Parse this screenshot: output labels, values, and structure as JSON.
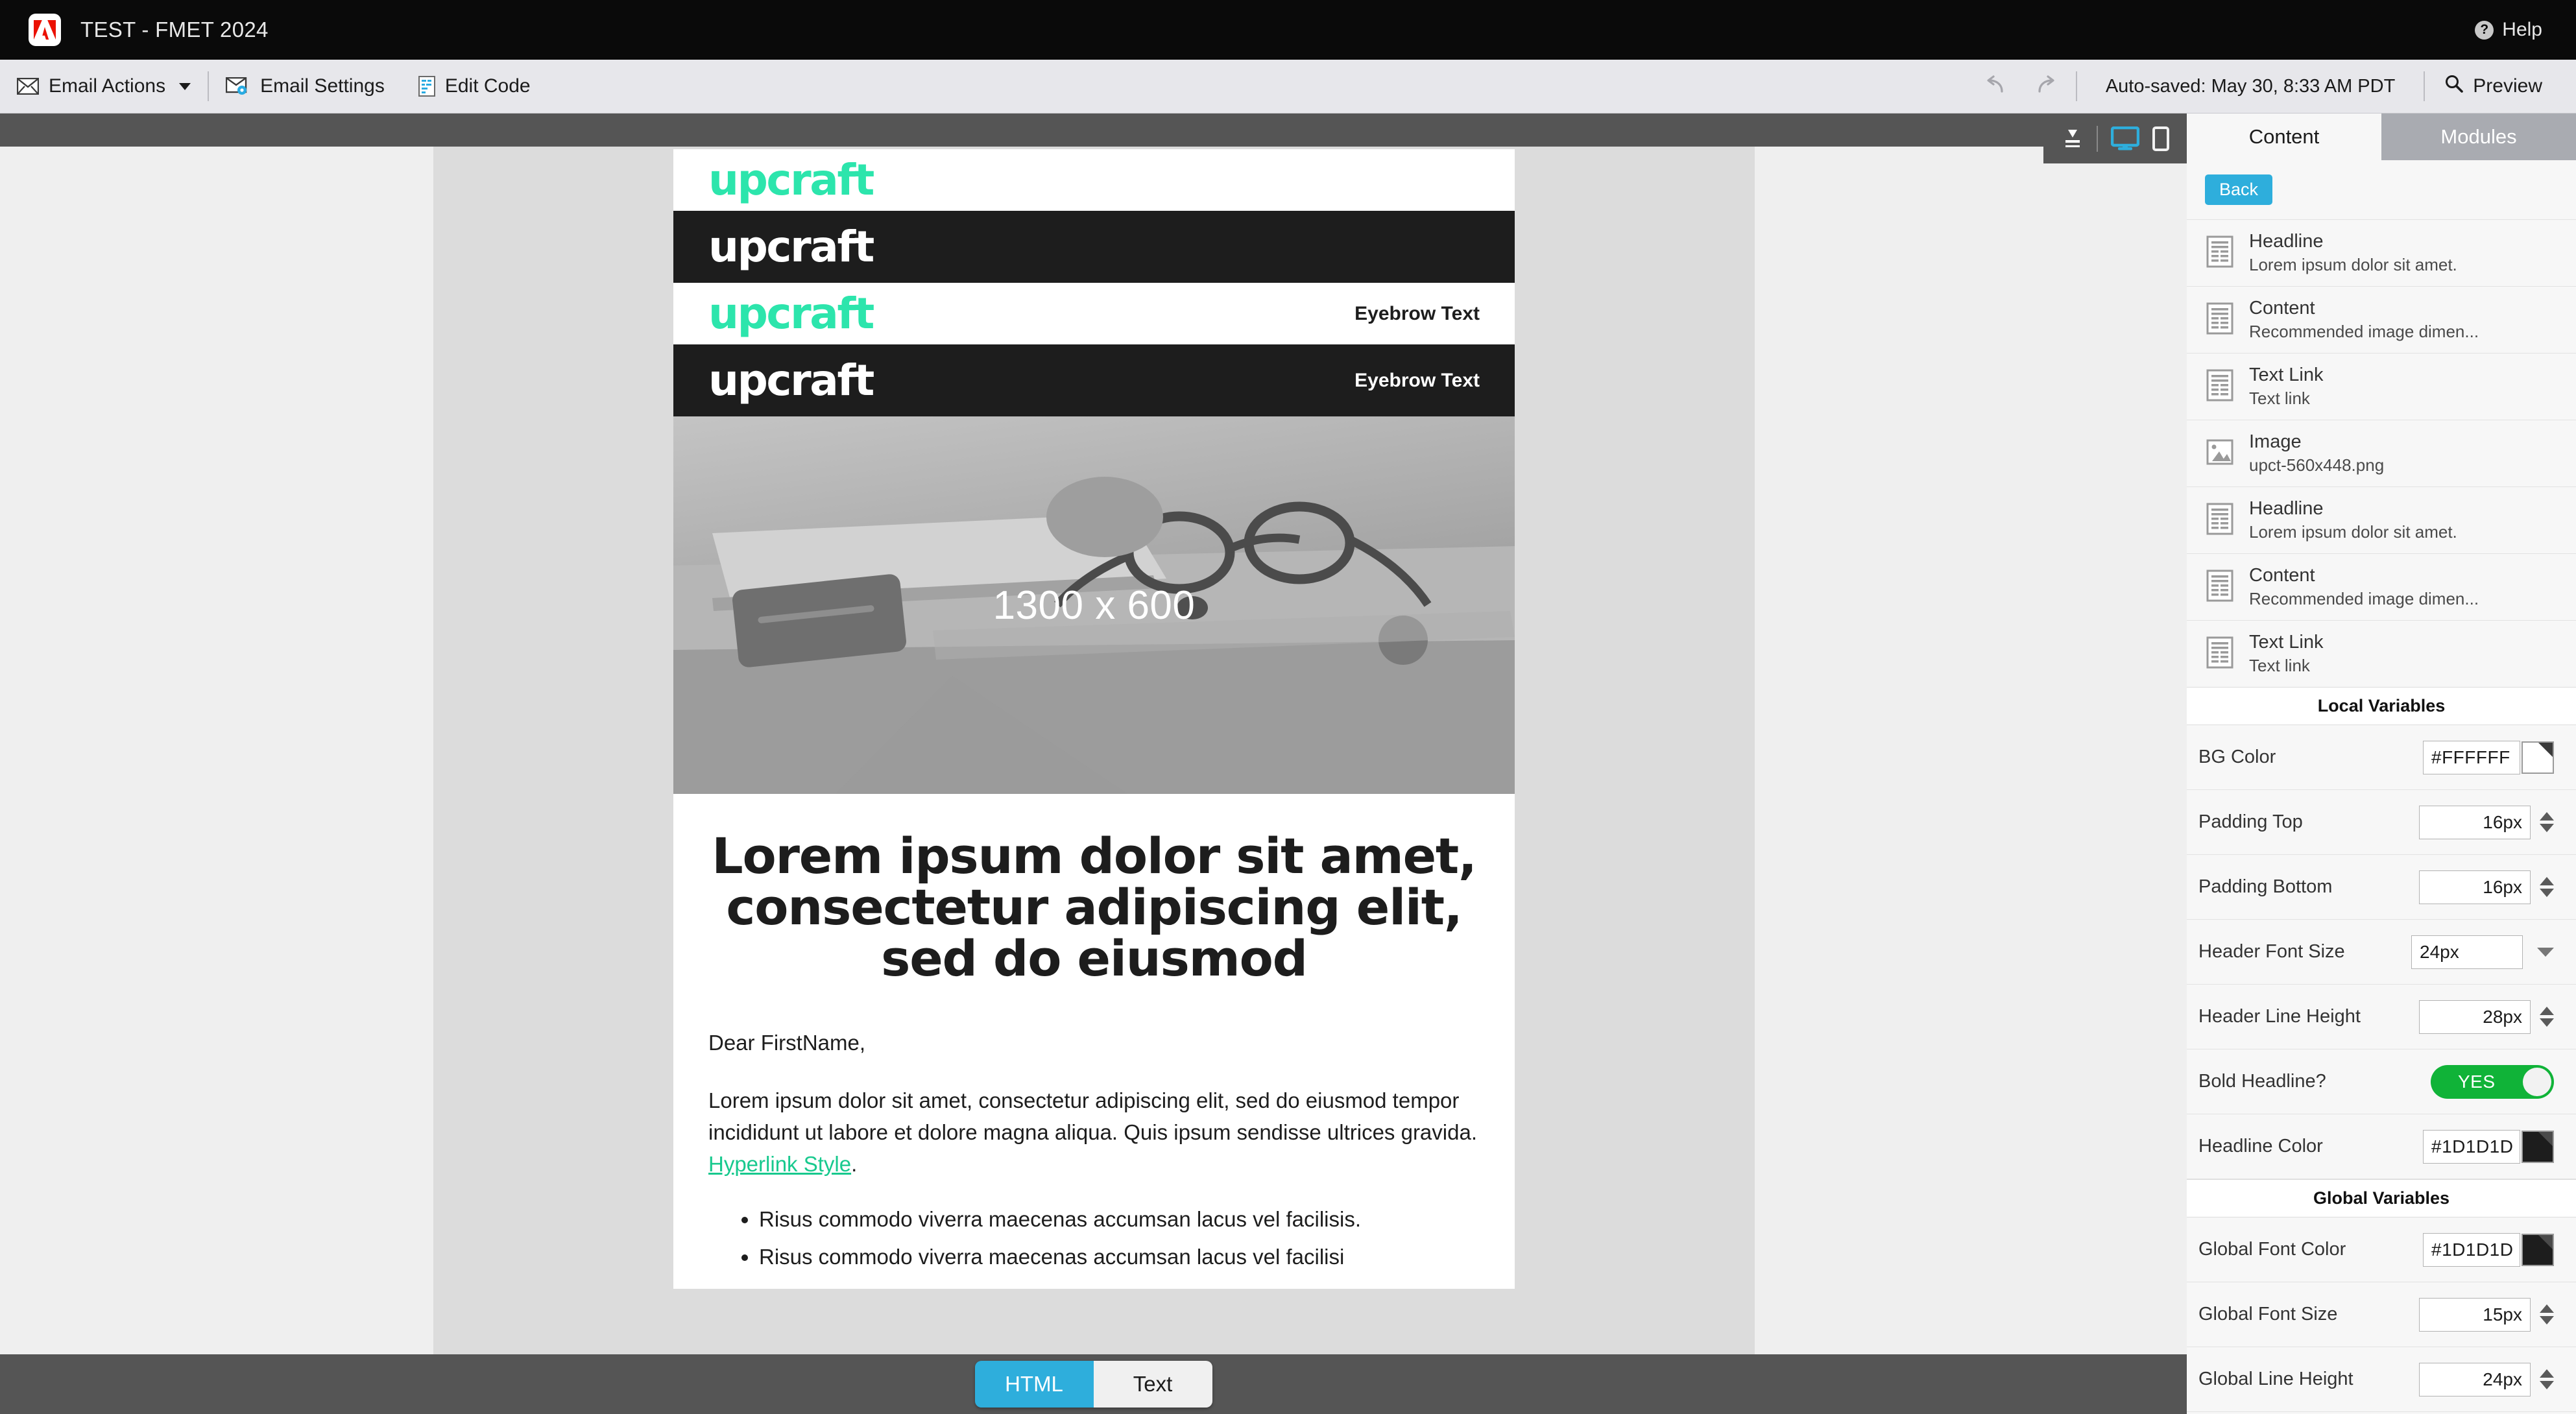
{
  "topbar": {
    "logo_icon": "adobe-logo-icon",
    "title": "TEST - FMET 2024",
    "help_label": "Help",
    "help_icon": "question-circle-icon"
  },
  "toolbar": {
    "email_actions": "Email Actions",
    "email_actions_icon": "envelope-icon",
    "email_settings": "Email Settings",
    "email_settings_icon": "envelope-gear-icon",
    "edit_code": "Edit Code",
    "edit_code_icon": "code-document-icon",
    "undo_icon": "undo-arrow-icon",
    "redo_icon": "redo-arrow-icon",
    "autosaved": "Auto-saved: May 30, 8:33 AM PDT",
    "preview": "Preview",
    "preview_icon": "magnifier-icon"
  },
  "device_toolbar": {
    "collapse_icon": "collapse-all-icon",
    "desktop_icon": "desktop-monitor-icon",
    "mobile_icon": "mobile-phone-icon",
    "active": "desktop",
    "active_color": "#2EAEDC"
  },
  "email": {
    "brand": "upcraft",
    "brand_teal": "#2CE5AC",
    "dark_bg": "#1D1D1D",
    "bands": [
      {
        "logo": "upcraft",
        "theme": "white",
        "eyebrow": ""
      },
      {
        "logo": "upcraft",
        "theme": "dark",
        "eyebrow": ""
      },
      {
        "logo": "upcraft",
        "theme": "white",
        "eyebrow": "Eyebrow Text"
      },
      {
        "logo": "upcraft",
        "theme": "dark",
        "eyebrow": "Eyebrow Text"
      }
    ],
    "hero_label": "1300 x 600",
    "headline": "Lorem ipsum dolor sit amet, consectetur adipiscing elit, sed do eiusmod",
    "salutation": "Dear FirstName,",
    "paragraph": "Lorem ipsum dolor sit amet, consectetur adipiscing elit, sed do eiusmod tempor incididunt ut labore et dolore magna aliqua. Quis ipsum sendisse ultrices gravida. ",
    "hyperlink_text": "Hyperlink Style",
    "hyperlink_color": "#18C98E",
    "paragraph_end": ".",
    "bullets": [
      "Risus commodo viverra maecenas accumsan lacus vel facilisis.",
      "Risus commodo viverra maecenas accumsan lacus vel facilisi"
    ]
  },
  "bottom_toggle": {
    "html_label": "HTML",
    "text_label": "Text",
    "active": "HTML",
    "active_color": "#2EAEDC"
  },
  "panel": {
    "tabs": [
      {
        "label": "Content",
        "active": true
      },
      {
        "label": "Modules",
        "active": false
      }
    ],
    "back_label": "Back",
    "back_color": "#2EAEDC",
    "modules": [
      {
        "icon": "text-document-icon",
        "title": "Headline",
        "sub": "Lorem ipsum dolor sit amet."
      },
      {
        "icon": "text-document-icon",
        "title": "Content",
        "sub": "Recommended image dimen..."
      },
      {
        "icon": "text-document-icon",
        "title": "Text Link",
        "sub": "Text link"
      },
      {
        "icon": "image-placeholder-icon",
        "title": "Image",
        "sub": "upct-560x448.png"
      },
      {
        "icon": "text-document-icon",
        "title": "Headline",
        "sub": "Lorem ipsum dolor sit amet."
      },
      {
        "icon": "text-document-icon",
        "title": "Content",
        "sub": "Recommended image dimen..."
      },
      {
        "icon": "text-document-icon",
        "title": "Text Link",
        "sub": "Text link"
      }
    ],
    "local_header": "Local Variables",
    "local_vars": [
      {
        "label": "BG Color",
        "value": "#FFFFFF",
        "control": "color",
        "swatch": "#FFFFFF"
      },
      {
        "label": "Padding Top",
        "value": "16px",
        "control": "number"
      },
      {
        "label": "Padding Bottom",
        "value": "16px",
        "control": "number"
      },
      {
        "label": "Header Font Size",
        "value": "24px",
        "control": "select"
      },
      {
        "label": "Header Line Height",
        "value": "28px",
        "control": "number"
      },
      {
        "label": "Bold Headline?",
        "value": "YES",
        "control": "toggle",
        "on": true,
        "on_color": "#10B338"
      },
      {
        "label": "Headline Color",
        "value": "#1D1D1D",
        "control": "color",
        "swatch": "#1D1D1D"
      }
    ],
    "global_header": "Global Variables",
    "global_vars": [
      {
        "label": "Global Font Color",
        "value": "#1D1D1D",
        "control": "color",
        "swatch": "#1D1D1D"
      },
      {
        "label": "Global Font Size",
        "value": "15px",
        "control": "number"
      },
      {
        "label": "Global Line Height",
        "value": "24px",
        "control": "number"
      }
    ]
  }
}
